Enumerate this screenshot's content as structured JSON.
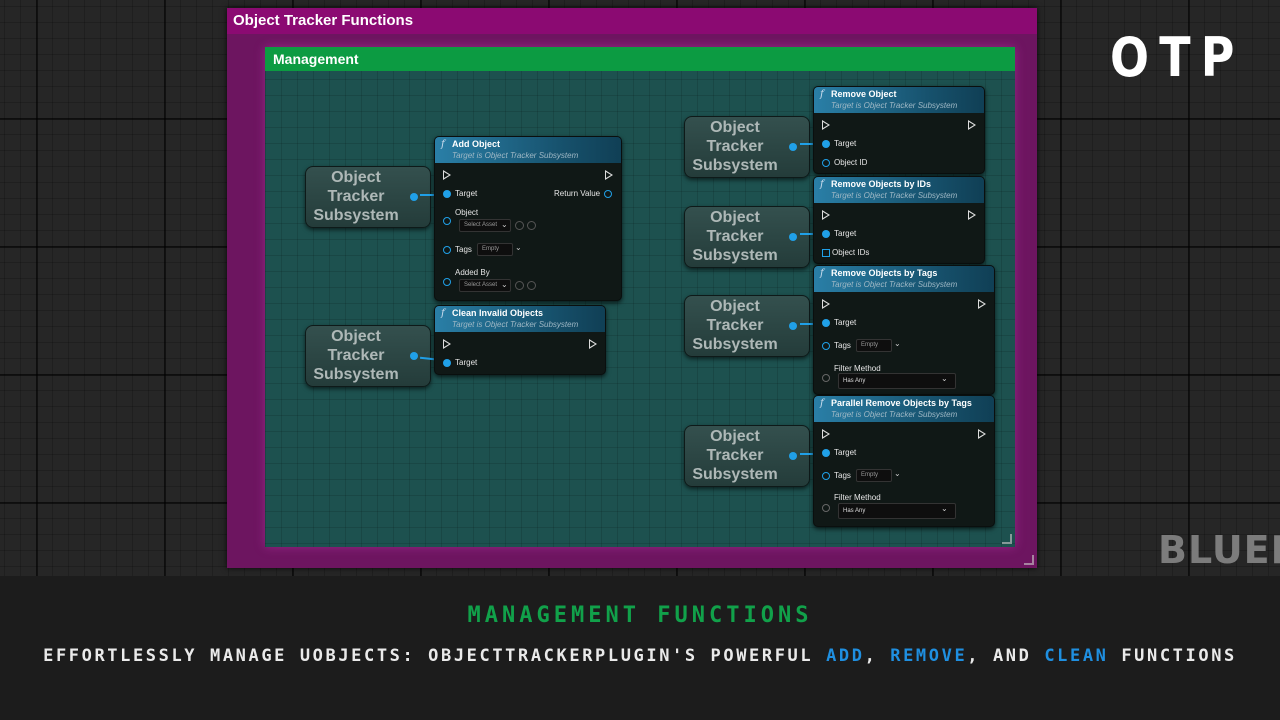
{
  "outer_comment": {
    "title": "Object Tracker Functions"
  },
  "inner_comment": {
    "title": "Management"
  },
  "variable_label": "Object\nTracker\nSubsystem",
  "target_subtitle": "Target is Object Tracker Subsystem",
  "pins": {
    "target": "Target",
    "return_value": "Return Value",
    "object": "Object",
    "tags": "Tags",
    "added_by": "Added By",
    "object_id": "Object ID",
    "object_ids": "Object IDs",
    "filter_method": "Filter Method"
  },
  "widgets": {
    "select_asset": "Select Asset",
    "empty": "Empty",
    "has_any": "Has Any"
  },
  "nodes": {
    "add_object": "Add Object",
    "clean_invalid_objects": "Clean Invalid Objects",
    "remove_object": "Remove Object",
    "remove_objects_by_ids": "Remove Objects by IDs",
    "remove_objects_by_tags": "Remove Objects by Tags",
    "parallel_remove_objects_by_tags": "Parallel Remove Objects by Tags"
  },
  "brand": {
    "logo": "OTP",
    "watermark": "BLUEP"
  },
  "banner": {
    "heading": "MANAGEMENT FUNCTIONS",
    "caption_prefix": "EFFORTLESSLY MANAGE UOBJECTS: OBJECTTRACKERPLUGIN'S POWERFUL",
    "add": "ADD",
    "sep1": ",",
    "remove": "REMOVE",
    "sep2": ", AND",
    "clean": "CLEAN",
    "suffix": "FUNCTIONS"
  },
  "colors": {
    "outer_comment": "#8b0a72",
    "inner_comment": "#0c9b42",
    "pin_blue": "#20a0e8",
    "heading_green": "#11a14a",
    "highlight_blue": "#1f8fe0"
  },
  "icons": [
    "function-icon",
    "exec-pin-icon",
    "object-pin-icon",
    "dropdown-chevron-icon",
    "add-element-icon",
    "browse-icon",
    "array-pin-icon",
    "resize-handle-icon"
  ]
}
